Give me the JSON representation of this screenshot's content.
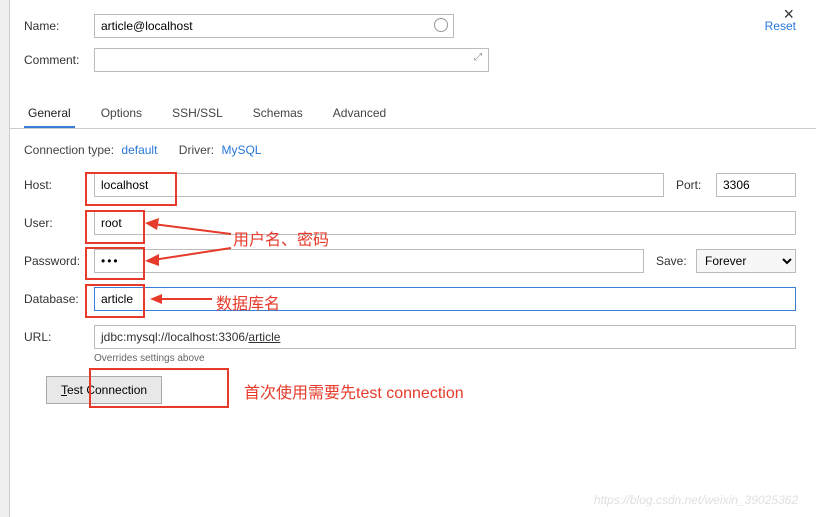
{
  "header": {
    "name_label": "Name:",
    "name_value": "article@localhost",
    "comment_label": "Comment:",
    "reset": "Reset"
  },
  "tabs": {
    "general": "General",
    "options": "Options",
    "ssh": "SSH/SSL",
    "schemas": "Schemas",
    "advanced": "Advanced"
  },
  "conn": {
    "type_label": "Connection type:",
    "type_value": "default",
    "driver_label": "Driver:",
    "driver_value": "MySQL"
  },
  "fields": {
    "host_label": "Host:",
    "host_value": "localhost",
    "port_label": "Port:",
    "port_value": "3306",
    "user_label": "User:",
    "user_value": "root",
    "password_label": "Password:",
    "password_value": "•••",
    "save_label": "Save:",
    "save_value": "Forever",
    "database_label": "Database:",
    "database_value": "article",
    "url_label": "URL:",
    "url_prefix": "jdbc:mysql://localhost:3306/",
    "url_db": "article",
    "url_note": "Overrides settings above"
  },
  "test": {
    "button_prefix": "T",
    "button_rest": "est Connection"
  },
  "annotations": {
    "user_pwd": "用户名、密码",
    "db_name": "数据库名",
    "test_note": "首次使用需要先test connection"
  },
  "watermark": "https://blog.csdn.net/weixin_39025362"
}
